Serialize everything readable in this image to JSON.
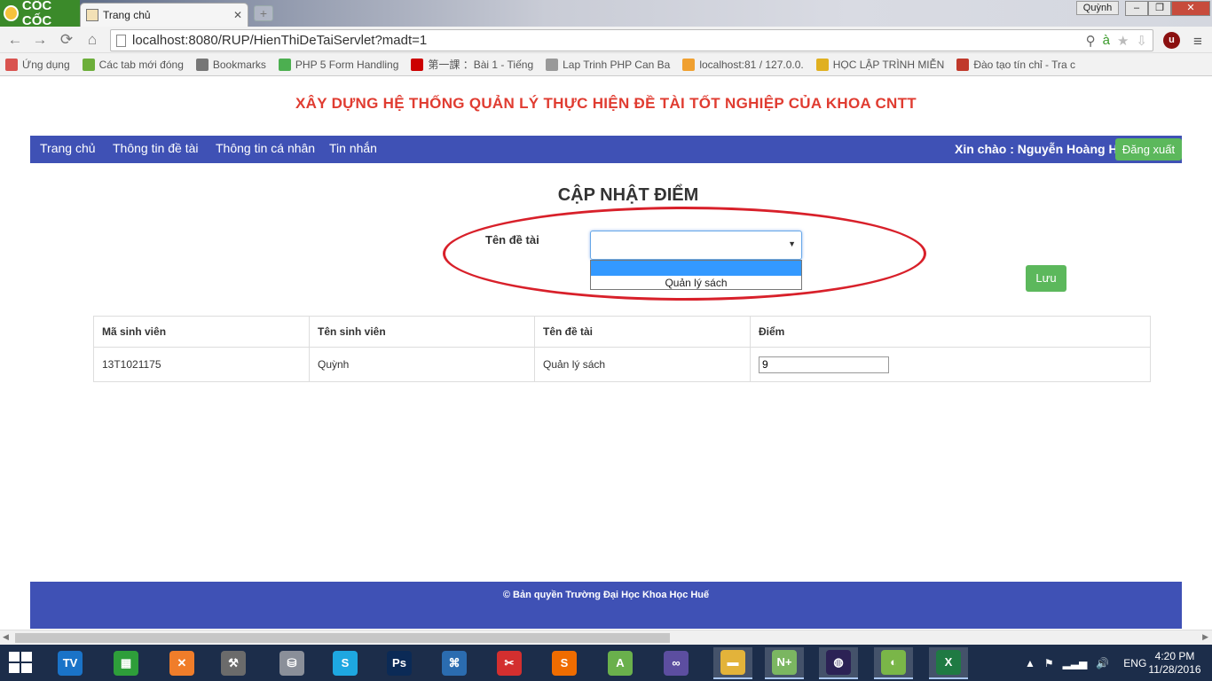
{
  "browser": {
    "logo_text": "CỐC CỐC",
    "tab_title": "Trang chủ",
    "tab_close": "✕",
    "new_tab": "+",
    "user_name": "Quỳnh",
    "url": "localhost:8080/RUP/HienThiDeTaiServlet?madt=1",
    "window_controls": {
      "minimize": "–",
      "maximize": "❐",
      "close": "✕"
    },
    "nav": {
      "back": "←",
      "forward": "→",
      "reload": "⟳",
      "home": "⌂"
    },
    "omnibox_icons": {
      "zoom": "⚲",
      "extension": "à",
      "star": "★",
      "download": "⇩"
    },
    "ext_badge": "u",
    "menu": "≡",
    "bookmarks": [
      {
        "label": "Ứng dụng",
        "icon": "apps-icon",
        "color": "#d9534f"
      },
      {
        "label": "Các tab mới đóng",
        "icon": "recent-tabs-icon",
        "color": "#6cae3a"
      },
      {
        "label": "Bookmarks",
        "icon": "star-icon",
        "color": "#777777"
      },
      {
        "label": "PHP 5 Form Handling",
        "icon": "w3-icon",
        "color": "#4caf50"
      },
      {
        "label": "第一課 ：Bài 1 - Tiếng",
        "icon": "japan-flag-icon",
        "color": "#cc0000"
      },
      {
        "label": "Lap Trinh PHP Can Ba",
        "icon": "page-icon",
        "color": "#999999"
      },
      {
        "label": "localhost:81 / 127.0.0.",
        "icon": "pma-icon",
        "color": "#f0a030"
      },
      {
        "label": "HỌC LẬP TRÌNH MIỄN",
        "icon": "site-icon",
        "color": "#e0b020"
      },
      {
        "label": "Đào tạo tín chỉ - Tra c",
        "icon": "shield-icon",
        "color": "#c0392b"
      }
    ]
  },
  "site": {
    "title": "XÂY DỰNG HỆ THỐNG QUẢN LÝ THỰC HIỆN ĐỀ TÀI TỐT NGHIỆP CỦA KHOA CNTT",
    "nav": [
      {
        "label": "Trang chủ"
      },
      {
        "label": "Thông tin đề tài"
      },
      {
        "label": "Thông tin cá nhân"
      },
      {
        "label": "Tin nhắn"
      }
    ],
    "greeting": "Xin chào : Nguyễn Hoàng Hà",
    "logout": "Đăng xuất"
  },
  "form": {
    "heading": "CẬP NHẬT ĐIỂM",
    "topic_label": "Tên đề tài",
    "select_value": "",
    "select_arrow": "▼",
    "options": [
      "",
      "Quản lý sách"
    ],
    "save": "Lưu"
  },
  "table": {
    "headers": [
      "Mã sinh viên",
      "Tên sinh viên",
      "Tên đề tài",
      "Điểm"
    ],
    "rows": [
      {
        "student_id": "13T1021175",
        "student_name": "Quỳnh",
        "topic": "Quản lý sách",
        "score": "9"
      }
    ]
  },
  "footer": {
    "text": "© Bản quyền Trường Đại Học Khoa Học Huế"
  },
  "taskbar": {
    "language": "ENG",
    "time": "4:20 PM",
    "date": "11/28/2016",
    "apps": [
      {
        "name": "teamviewer-icon",
        "label": "TV",
        "color": "#1a73c8"
      },
      {
        "name": "store-icon",
        "label": "▦",
        "color": "#2e9e3a"
      },
      {
        "name": "xampp-icon",
        "label": "✕",
        "color": "#f07d2a"
      },
      {
        "name": "tools-icon",
        "label": "⚒",
        "color": "#6b6b6b"
      },
      {
        "name": "database-icon",
        "label": "⛁",
        "color": "#8a8f99"
      },
      {
        "name": "skype-icon",
        "label": "S",
        "color": "#1ea7e1"
      },
      {
        "name": "photoshop-icon",
        "label": "Ps",
        "color": "#0b2a56"
      },
      {
        "name": "sourcetree-icon",
        "label": "⌘",
        "color": "#2b6cb0"
      },
      {
        "name": "foxit-icon",
        "label": "✂",
        "color": "#d32f2f"
      },
      {
        "name": "sublime-icon",
        "label": "S",
        "color": "#ef6c00"
      },
      {
        "name": "android-studio-icon",
        "label": "A",
        "color": "#6ab04c"
      },
      {
        "name": "visual-studio-icon",
        "label": "∞",
        "color": "#5c4ea0"
      },
      {
        "name": "explorer-icon",
        "label": "▬",
        "color": "#e3b33a"
      },
      {
        "name": "notepad-plus-icon",
        "label": "N+",
        "color": "#7bb661"
      },
      {
        "name": "eclipse-icon",
        "label": "◍",
        "color": "#2c2255"
      },
      {
        "name": "coccoc-icon",
        "label": "◐",
        "color": "#7ab648"
      },
      {
        "name": "excel-icon",
        "label": "X",
        "color": "#1f7a43"
      }
    ],
    "tray": {
      "arrow": "▲",
      "flag": "⚑",
      "signal": "▂▃▅",
      "volume": "🔊"
    }
  }
}
